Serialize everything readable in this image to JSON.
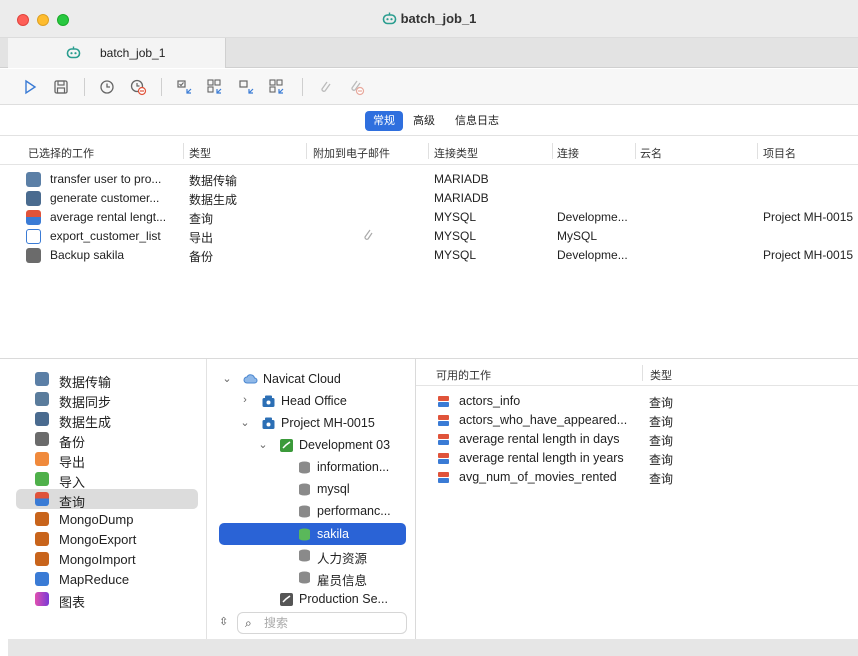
{
  "window": {
    "title": "batch_job_1"
  },
  "tabs": [
    {
      "label": "batch_job_1"
    }
  ],
  "toolbar": {
    "icons": [
      "run-icon",
      "save-icon",
      "schedule-icon",
      "remove-schedule-icon",
      "select-all-icon",
      "select-all-alt-icon",
      "deselect-icon",
      "deselect-alt-icon",
      "attach-icon",
      "remove-attach-icon"
    ]
  },
  "segments": {
    "general": "常规",
    "advanced": "高级",
    "log": "信息日志",
    "active": "general"
  },
  "selected_jobs": {
    "headers": [
      "已选择的工作",
      "类型",
      "附加到电子邮件",
      "连接类型",
      "连接",
      "云名",
      "项目名"
    ],
    "rows": [
      {
        "name": "transfer user to pro...",
        "type": "数据传输",
        "attach": "",
        "conn_type": "MARIADB",
        "conn": "",
        "cloud": "",
        "project": "",
        "icon": "data-transfer-icon",
        "color": "#5b7fa6"
      },
      {
        "name": "generate customer...",
        "type": "数据生成",
        "attach": "",
        "conn_type": "MARIADB",
        "conn": "",
        "cloud": "",
        "project": "",
        "icon": "data-generation-icon",
        "color": "#4a6b8f"
      },
      {
        "name": "average rental lengt...",
        "type": "查询",
        "attach": "",
        "conn_type": "MYSQL",
        "conn": "Developme...",
        "cloud": "",
        "project": "Project MH-0015",
        "icon": "query-icon",
        "color": "#e0533a"
      },
      {
        "name": "export_customer_list",
        "type": "导出",
        "attach": "attach",
        "conn_type": "MYSQL",
        "conn": "MySQL",
        "cloud": "",
        "project": "",
        "icon": "export-icon",
        "color": "#3a7bd5"
      },
      {
        "name": "Backup sakila",
        "type": "备份",
        "attach": "",
        "conn_type": "MYSQL",
        "conn": "Developme...",
        "cloud": "",
        "project": "Project MH-0015",
        "icon": "backup-icon",
        "color": "#6b6b6b"
      }
    ]
  },
  "job_types": [
    {
      "label": "数据传输",
      "icon": "data-transfer-icon",
      "color": "#5b7fa6"
    },
    {
      "label": "数据同步",
      "icon": "data-sync-icon",
      "color": "#5a7c9c"
    },
    {
      "label": "数据生成",
      "icon": "data-generation-icon",
      "color": "#4a6b8f"
    },
    {
      "label": "备份",
      "icon": "backup-icon",
      "color": "#6b6b6b"
    },
    {
      "label": "导出",
      "icon": "export-icon",
      "color": "#f08a3c"
    },
    {
      "label": "导入",
      "icon": "import-icon",
      "color": "#4fb04a"
    },
    {
      "label": "查询",
      "icon": "query-icon",
      "color": "#e0533a",
      "selected": true
    },
    {
      "label": "MongoDump",
      "icon": "mongodump-icon",
      "color": "#c8641c"
    },
    {
      "label": "MongoExport",
      "icon": "mongoexport-icon",
      "color": "#c8641c"
    },
    {
      "label": "MongoImport",
      "icon": "mongoimport-icon",
      "color": "#c8641c"
    },
    {
      "label": "MapReduce",
      "icon": "mapreduce-icon",
      "color": "#3a7bd5"
    },
    {
      "label": "图表",
      "icon": "chart-icon",
      "color": "#b03ad5"
    }
  ],
  "tree": [
    {
      "label": "Navicat Cloud",
      "chev": "⌄",
      "icon": "cloud-icon"
    },
    {
      "label": "Head Office",
      "chev": "›",
      "icon": "project-icon"
    },
    {
      "label": "Project MH-0015",
      "chev": "⌄",
      "icon": "project-icon"
    },
    {
      "label": "Development 03",
      "chev": "⌄",
      "icon": "connection-icon"
    },
    {
      "label": "information...",
      "chev": "",
      "icon": "database-icon"
    },
    {
      "label": "mysql",
      "chev": "",
      "icon": "database-icon"
    },
    {
      "label": "performanc...",
      "chev": "",
      "icon": "database-icon"
    },
    {
      "label": "sakila",
      "chev": "",
      "icon": "database-icon",
      "selected": true
    },
    {
      "label": "人力资源",
      "chev": "",
      "icon": "database-icon"
    },
    {
      "label": "雇员信息",
      "chev": "",
      "icon": "database-icon"
    },
    {
      "label": "Production Se...",
      "chev": "",
      "icon": "connection-icon"
    }
  ],
  "search": {
    "placeholder": "搜索",
    "value": ""
  },
  "available_jobs": {
    "headers": [
      "可用的工作",
      "类型"
    ],
    "rows": [
      {
        "name": "actors_info",
        "type": "查询"
      },
      {
        "name": "actors_who_have_appeared...",
        "type": "查询"
      },
      {
        "name": "average rental length in days",
        "type": "查询"
      },
      {
        "name": "average rental length in years",
        "type": "查询"
      },
      {
        "name": "avg_num_of_movies_rented",
        "type": "查询"
      }
    ]
  }
}
